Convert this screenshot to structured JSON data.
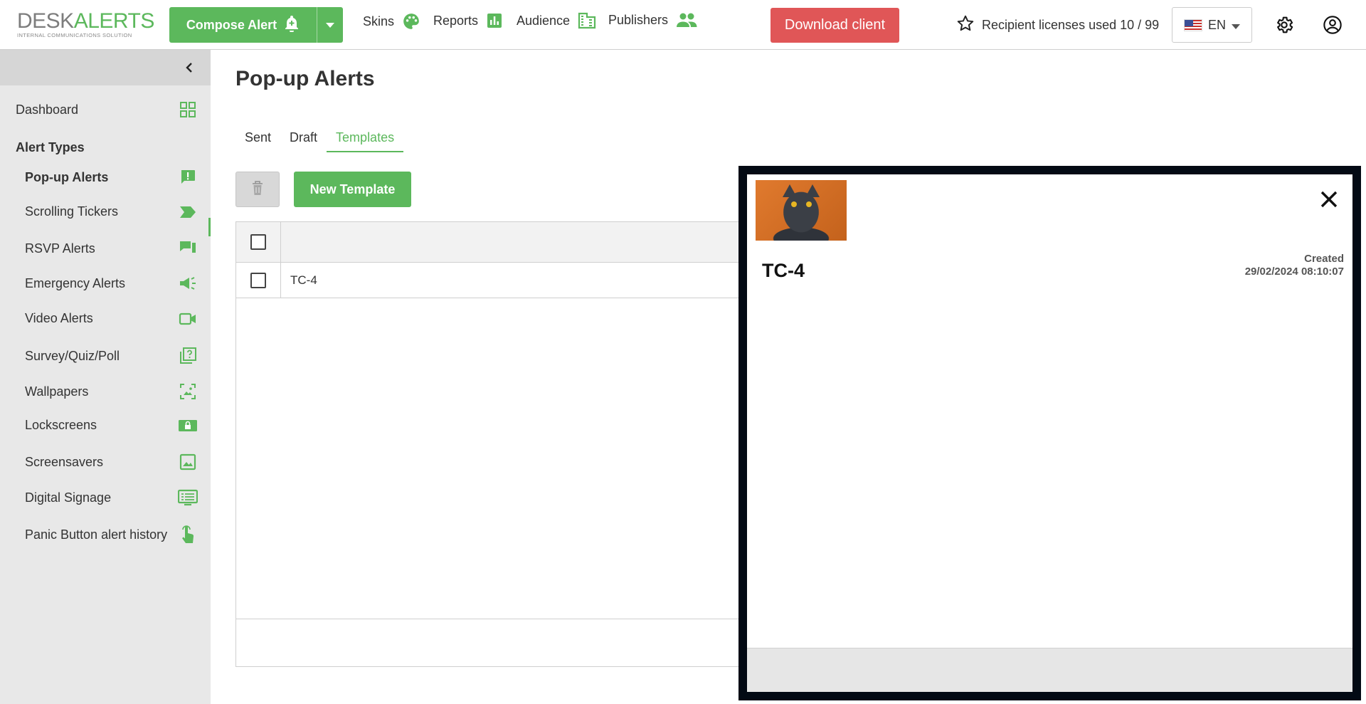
{
  "header": {
    "logo_main_1": "DESK",
    "logo_main_2": "ALERTS",
    "logo_sub": "INTERNAL COMMUNICATIONS SOLUTION",
    "compose_label": "Compose Alert",
    "nav": [
      {
        "label": "Skins",
        "icon": "palette-icon"
      },
      {
        "label": "Reports",
        "icon": "bar-chart-icon"
      },
      {
        "label": "Audience",
        "icon": "building-icon"
      },
      {
        "label": "Publishers",
        "icon": "people-icon"
      }
    ],
    "download_label": "Download client",
    "licenses_label": "Recipient licenses used 10 / 99",
    "language": "EN"
  },
  "sidebar": {
    "dashboard": "Dashboard",
    "section_heading": "Alert Types",
    "items": [
      {
        "label": "Pop-up Alerts",
        "icon": "alert-bubble-icon"
      },
      {
        "label": "Scrolling Tickers",
        "icon": "tag-arrow-icon"
      },
      {
        "label": "RSVP Alerts",
        "icon": "chat-bubbles-icon"
      },
      {
        "label": "Emergency Alerts",
        "icon": "megaphone-icon"
      },
      {
        "label": "Video Alerts",
        "icon": "video-camera-icon"
      },
      {
        "label": "Survey/Quiz/Poll",
        "icon": "question-icon"
      },
      {
        "label": "Wallpapers",
        "icon": "wallpaper-icon"
      },
      {
        "label": "Lockscreens",
        "icon": "lock-screen-icon"
      },
      {
        "label": "Screensavers",
        "icon": "image-icon"
      },
      {
        "label": "Digital Signage",
        "icon": "monitor-list-icon"
      },
      {
        "label": "Panic Button alert history",
        "icon": "touch-icon"
      }
    ]
  },
  "main": {
    "title": "Pop-up Alerts",
    "tabs": [
      {
        "label": "Sent",
        "active": false
      },
      {
        "label": "Draft",
        "active": false
      },
      {
        "label": "Templates",
        "active": true
      }
    ],
    "new_template_label": "New Template",
    "rows": [
      {
        "name": "TC-4"
      }
    ]
  },
  "popup": {
    "title": "TC-4",
    "created_label": "Created",
    "created_value": "29/02/2024 08:10:07"
  },
  "colors": {
    "accent": "#5cb85c",
    "danger": "#e05657",
    "sidebar_bg": "#e8e8e8",
    "popup_border": "#030a14"
  }
}
